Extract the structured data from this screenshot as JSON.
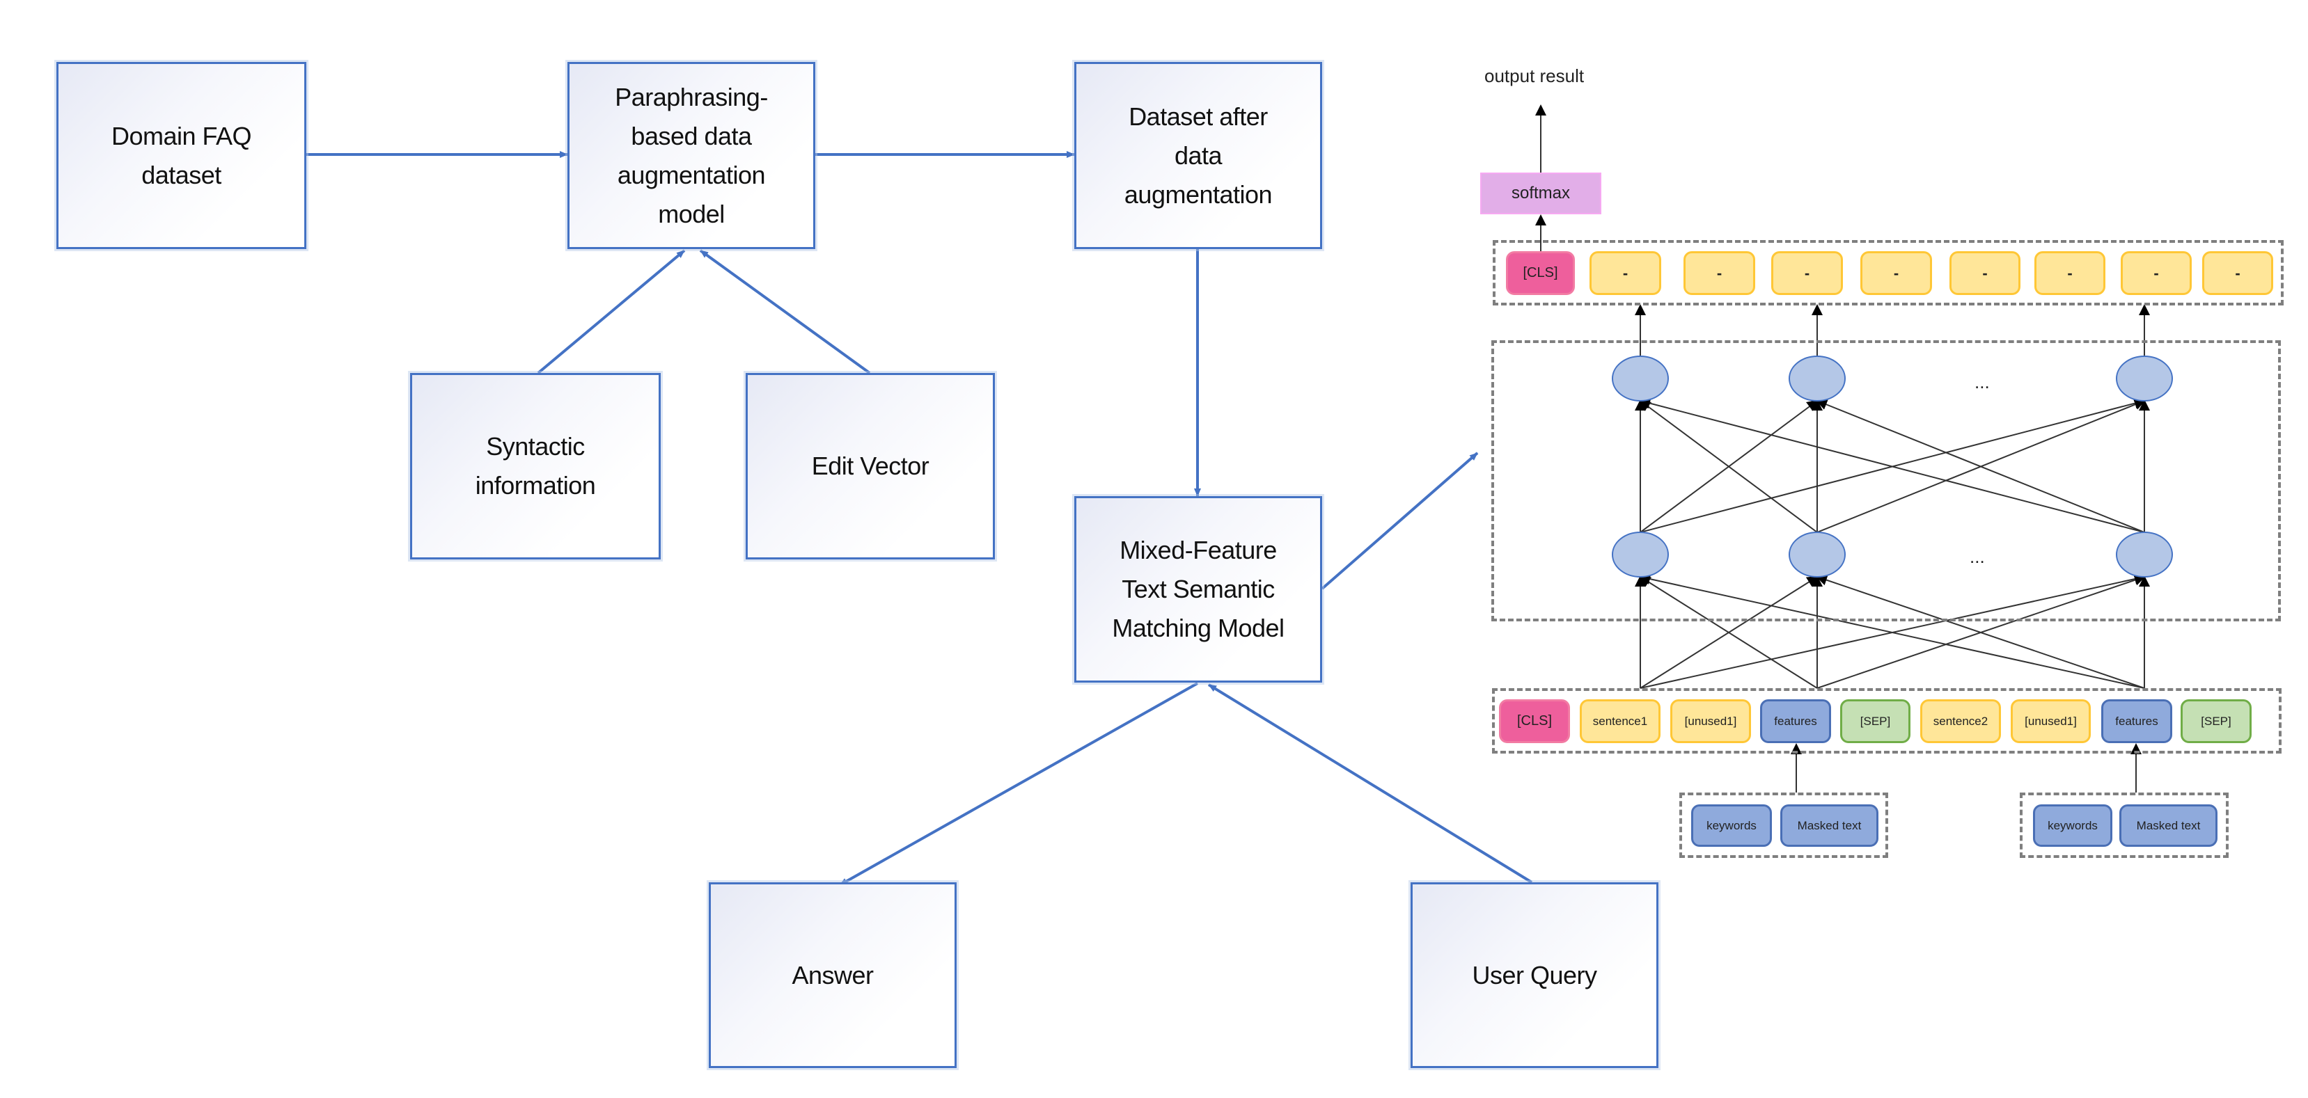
{
  "diagram": {
    "pipeline_boxes": {
      "domain_faq": "Domain FAQ\ndataset",
      "paraphrasing_model": "Paraphrasing-\nbased data\naugmentation\nmodel",
      "dataset_after": "Dataset after\ndata\naugmentation",
      "syntactic_info": "Syntactic\ninformation",
      "edit_vector": "Edit Vector",
      "matching_model": "Mixed-Feature\nText Semantic\nMatching Model",
      "answer": "Answer",
      "user_query": "User Query"
    },
    "network": {
      "output_label": "output result",
      "softmax_label": "softmax",
      "output_tokens": [
        "[CLS]",
        "-",
        "-",
        "-",
        "-",
        "-",
        "-",
        "-",
        "-"
      ],
      "hidden_ellipsis": "...",
      "input_tokens": [
        "[CLS]",
        "sentence1",
        "[unused1]",
        "features",
        "[SEP]",
        "sentence2",
        "[unused1]",
        "features",
        "[SEP]"
      ],
      "input_token_types": [
        "cls",
        "yellow",
        "yellow",
        "blue",
        "green",
        "yellow",
        "yellow",
        "blue",
        "green"
      ],
      "feature_sources": [
        {
          "keywords": "keywords",
          "masked": "Masked text"
        },
        {
          "keywords": "keywords",
          "masked": "Masked text"
        }
      ]
    },
    "colors": {
      "flow_line": "#4472C4",
      "net_line": "#333333",
      "neuron_fill": "#B4C7E7",
      "neuron_stroke": "#4472C4"
    }
  }
}
